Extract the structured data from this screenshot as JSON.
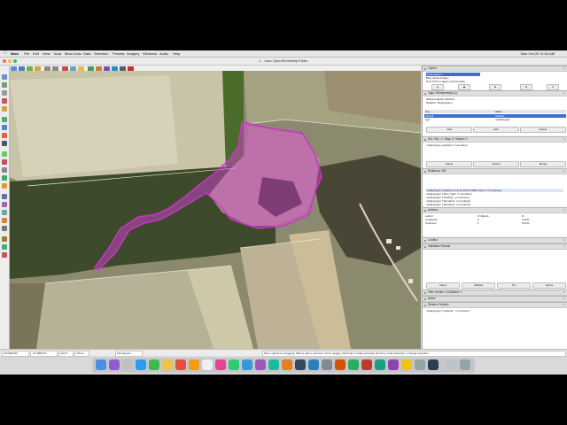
{
  "menubar": {
    "app": "Main",
    "items": [
      "Main",
      "File",
      "Edit",
      "View",
      "Tools",
      "More tools",
      "Data",
      "Selection",
      "Presets",
      "Imagery",
      "Windows",
      "Audio",
      "Help"
    ],
    "clock": "Mon Oct 22  11:04 AM"
  },
  "window": {
    "title": "1 - Java OpenStreetMap Editor"
  },
  "layers": {
    "header": "Layers",
    "items": [
      "Data Layer 1",
      "Bing aerial imagery",
      "NYS Ortho Imagery (Cycle) Data"
    ]
  },
  "tags": {
    "header": "Tags / Memberships (2)",
    "summary": [
      "Wetland Marsh Wetland",
      "Relation: Multipolygon"
    ],
    "col_key": "Key",
    "col_value": "Value",
    "rows": [
      {
        "key": "natural",
        "value": "wetland"
      },
      {
        "key": "type",
        "value": "multipolygon"
      }
    ],
    "buttons": [
      "Add",
      "Edit",
      "Delete"
    ]
  },
  "selection": {
    "header": "Sel.: Rel.: 1 / Way: 0 / Nodes: 0",
    "item": "multipolygon (wetland, 3 members)",
    "buttons": [
      "Select",
      "Search",
      "Merge"
    ]
  },
  "relations": {
    "header": "Relations: 350",
    "items": [
      "multipolygon (\"Addison County Fish & Wildl. Dept.\", 2 members)",
      "multipolygon (\"farm_field\", 2 members)",
      "multipolygon (\"building\", 2 members)",
      "multipolygon (\"farmland\", 3 members)",
      "multipolygon (\"farmland\", 2 members)"
    ]
  },
  "author": {
    "header": "Authors",
    "col_author": "Author",
    "col_objects": "# Objects",
    "col_pct": "%",
    "rows": [
      {
        "author": "woodpeck",
        "objects": "2",
        "pct": "0.02%"
      },
      {
        "author": "Unknown",
        "objects": "1",
        "pct": "0.01%"
      }
    ]
  },
  "conflict": {
    "header": "Conflict",
    "validation": "Validation Results"
  },
  "validation_buttons": [
    "Select",
    "Validate",
    "Fix",
    "Ignore"
  ],
  "filter": {
    "header": "Filter Hidden: 0 Disabled: 0",
    "notes": "Notes",
    "toolbox_header": "Relation Toolbox",
    "toolbox_item": "multipolygon (\"wetland\", 3 members)"
  },
  "status": {
    "lat": "44.0495123",
    "lon": "-73.2869727",
    "heading": "110.8 °",
    "dist": "3.53 m",
    "objects": "166 objects",
    "message": "Move objects by dragging; Shift to add to selection (Ctrl to toggle); Shift-Ctrl to rotate selected; Alt-Ctrl to scale selected; or change selection"
  },
  "colors": {
    "selected_outline": "#cc33cc",
    "selection_fill": "rgba(224,64,224,0.45)",
    "header_bar": "#dedede"
  },
  "icons": [
    "apple-icon",
    "close-icon",
    "minimize-icon",
    "maximize-icon",
    "open-icon",
    "save-icon",
    "undo-icon",
    "redo-icon",
    "select-icon",
    "zoom-icon",
    "draw-icon",
    "add-icon",
    "delete-icon",
    "search-icon",
    "gear-icon"
  ]
}
